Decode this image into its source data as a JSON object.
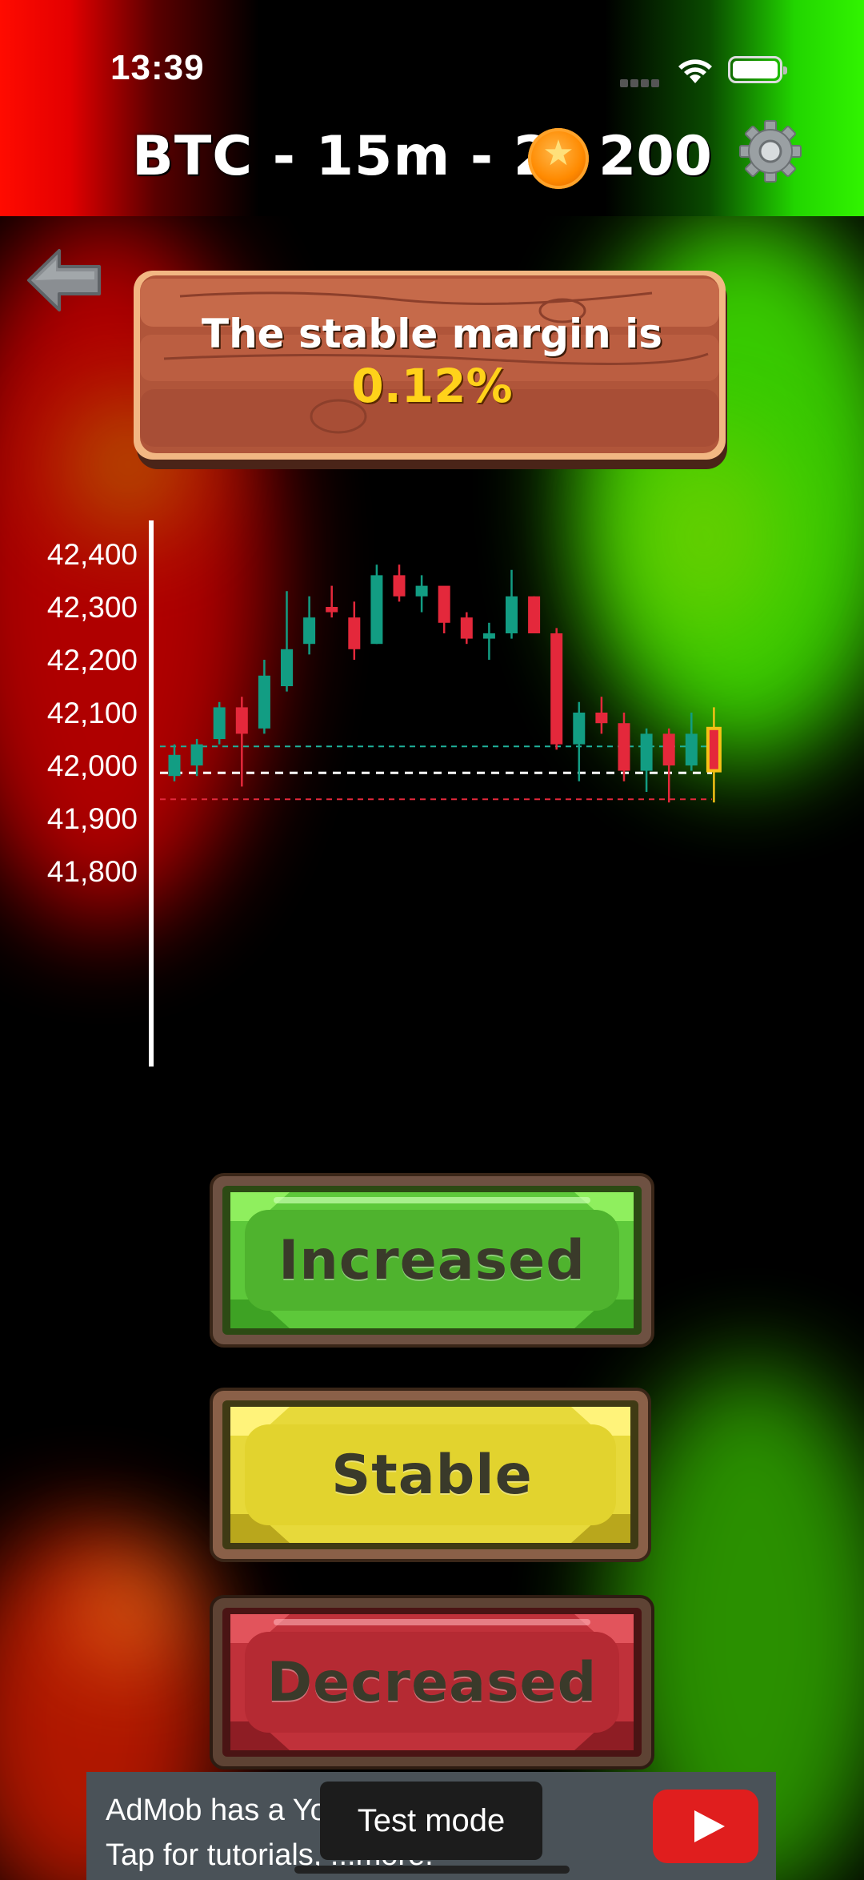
{
  "status_bar": {
    "time": "13:39"
  },
  "header": {
    "title": "BTC - 15m - 2",
    "coins": "200"
  },
  "sign": {
    "line1": "The stable margin is",
    "line2": "0.12%"
  },
  "chart_data": {
    "type": "candlestick",
    "yticks": [
      "42,400",
      "42,300",
      "42,200",
      "42,100",
      "42,000",
      "41,900",
      "41,800"
    ],
    "ylim": [
      41770,
      42440
    ],
    "reference_lines": {
      "upper": 42036,
      "current": 41986,
      "lower": 41936
    },
    "candles": [
      {
        "o": 41980,
        "h": 42040,
        "l": 41970,
        "c": 42020
      },
      {
        "o": 42000,
        "h": 42050,
        "l": 41980,
        "c": 42040
      },
      {
        "o": 42050,
        "h": 42120,
        "l": 42040,
        "c": 42110
      },
      {
        "o": 42110,
        "h": 42130,
        "l": 41960,
        "c": 42060
      },
      {
        "o": 42070,
        "h": 42200,
        "l": 42060,
        "c": 42170
      },
      {
        "o": 42150,
        "h": 42330,
        "l": 42140,
        "c": 42220
      },
      {
        "o": 42230,
        "h": 42320,
        "l": 42210,
        "c": 42280
      },
      {
        "o": 42300,
        "h": 42340,
        "l": 42280,
        "c": 42290
      },
      {
        "o": 42280,
        "h": 42310,
        "l": 42200,
        "c": 42220
      },
      {
        "o": 42230,
        "h": 42380,
        "l": 42230,
        "c": 42360
      },
      {
        "o": 42360,
        "h": 42380,
        "l": 42310,
        "c": 42320
      },
      {
        "o": 42320,
        "h": 42360,
        "l": 42290,
        "c": 42340
      },
      {
        "o": 42340,
        "h": 42330,
        "l": 42250,
        "c": 42270
      },
      {
        "o": 42280,
        "h": 42290,
        "l": 42230,
        "c": 42240
      },
      {
        "o": 42240,
        "h": 42270,
        "l": 42200,
        "c": 42250
      },
      {
        "o": 42250,
        "h": 42370,
        "l": 42240,
        "c": 42320
      },
      {
        "o": 42320,
        "h": 42320,
        "l": 42250,
        "c": 42250
      },
      {
        "o": 42250,
        "h": 42260,
        "l": 42030,
        "c": 42040
      },
      {
        "o": 42040,
        "h": 42120,
        "l": 41970,
        "c": 42100
      },
      {
        "o": 42100,
        "h": 42130,
        "l": 42060,
        "c": 42080
      },
      {
        "o": 42080,
        "h": 42100,
        "l": 41970,
        "c": 41990
      },
      {
        "o": 41990,
        "h": 42070,
        "l": 41950,
        "c": 42060
      },
      {
        "o": 42060,
        "h": 42070,
        "l": 41930,
        "c": 42000
      },
      {
        "o": 42000,
        "h": 42100,
        "l": 41990,
        "c": 42060
      },
      {
        "o": 41990,
        "h": 42110,
        "l": 41930,
        "c": 42070
      }
    ]
  },
  "buttons": {
    "increased": "Increased",
    "stable": "Stable",
    "decreased": "Decreased"
  },
  "ad": {
    "text": "AdMob has a Your...\nTap for tutorials, ...more.",
    "badge": "Test mode"
  },
  "colors": {
    "up": "#129d83",
    "down": "#e4283b",
    "highlight": "#f5c116"
  }
}
